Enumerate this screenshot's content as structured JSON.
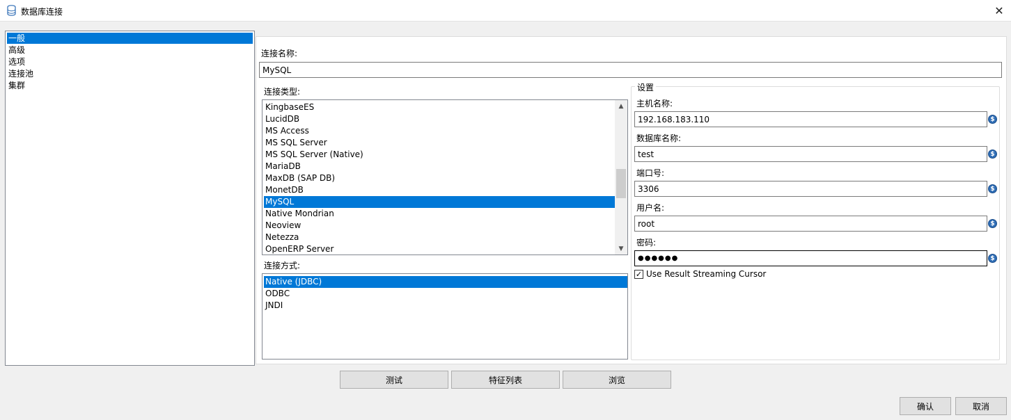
{
  "window": {
    "title": "数据库连接",
    "icon": "database-icon",
    "close_glyph": "✕"
  },
  "nav": {
    "items": [
      {
        "label": "一般",
        "selected": true
      },
      {
        "label": "高级",
        "selected": false
      },
      {
        "label": "选项",
        "selected": false
      },
      {
        "label": "连接池",
        "selected": false
      },
      {
        "label": "集群",
        "selected": false
      }
    ]
  },
  "connection_name": {
    "label": "连接名称:",
    "value": "MySQL"
  },
  "connection_type": {
    "label": "连接类型:",
    "items": [
      "KingbaseES",
      "LucidDB",
      "MS Access",
      "MS SQL Server",
      "MS SQL Server (Native)",
      "MariaDB",
      "MaxDB (SAP DB)",
      "MonetDB",
      "MySQL",
      "Native Mondrian",
      "Neoview",
      "Netezza",
      "OpenERP Server"
    ],
    "selected": "MySQL",
    "scroll_up_glyph": "▲",
    "scroll_down_glyph": "▼"
  },
  "access_method": {
    "label": "连接方式:",
    "items": [
      "Native (JDBC)",
      "ODBC",
      "JNDI"
    ],
    "selected": "Native (JDBC)"
  },
  "settings": {
    "legend": "设置",
    "host_label": "主机名称:",
    "host_value": "192.168.183.110",
    "db_label": "数据库名称:",
    "db_value": "test",
    "port_label": "端口号:",
    "port_value": "3306",
    "user_label": "用户名:",
    "user_value": "root",
    "password_label": "密码:",
    "password_value": "●●●●●●",
    "variable_icon_glyph": "$",
    "streaming_cursor_label": "Use Result Streaming Cursor",
    "streaming_cursor_checked": true,
    "check_glyph": "✓"
  },
  "buttons": {
    "test": "测试",
    "feature_list": "特征列表",
    "explore": "浏览",
    "ok": "确认",
    "cancel": "取消"
  },
  "colors": {
    "selection": "#0078d7",
    "dialog_bg": "#f0f0f0",
    "button_bg": "#e1e1e1"
  }
}
